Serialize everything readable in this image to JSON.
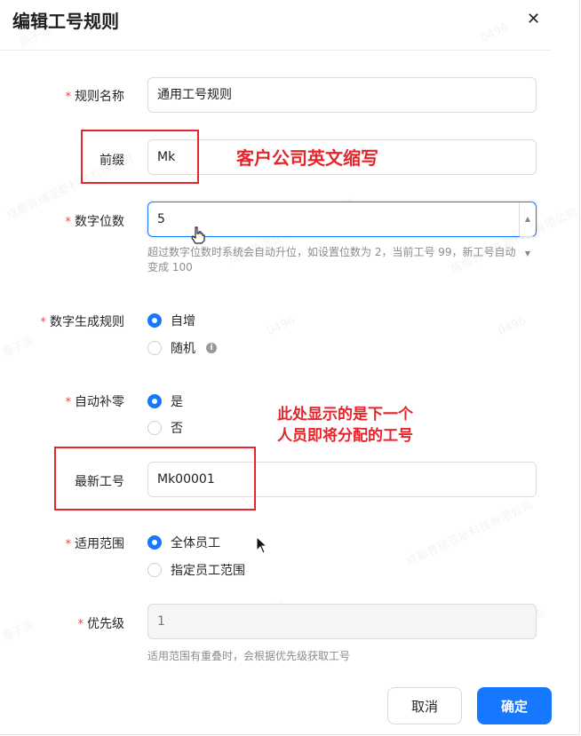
{
  "dialog": {
    "title": "编辑工号规则",
    "close_icon": "close-icon"
  },
  "form": {
    "rule_name": {
      "label": "规则名称",
      "required": "*",
      "value": "通用工号规则"
    },
    "prefix": {
      "label": "前缀",
      "value": "Mk"
    },
    "digit_count": {
      "label": "数字位数",
      "required": "*",
      "value": "5",
      "hint_line1": "超过数字位数时系统会自动升位，如设置位数为 2，当前工号 99，新工号自动",
      "hint_line2": "变成 100"
    },
    "generation_rule": {
      "label": "数字生成规则",
      "required": "*",
      "options": [
        "自增",
        "随机"
      ],
      "selected": "自增",
      "info_icon": "i"
    },
    "zero_padding": {
      "label": "自动补零",
      "required": "*",
      "options": [
        "是",
        "否"
      ],
      "selected": "是"
    },
    "latest_number": {
      "label": "最新工号",
      "value": "Mk00001"
    },
    "scope": {
      "label": "适用范围",
      "required": "*",
      "options": [
        "全体员工",
        "指定员工范围"
      ],
      "selected": "全体员工"
    },
    "priority": {
      "label": "优先级",
      "required": "*",
      "placeholder": "1",
      "hint": "适用范围有重叠时，会根据优先级获取工号"
    }
  },
  "footer": {
    "cancel_label": "取消",
    "confirm_label": "确定"
  },
  "annotations": {
    "prefix_note": "客户公司英文缩写",
    "latest_note_line1": "此处显示的是下一个",
    "latest_note_line2": "人员即将分配的工号"
  },
  "watermark": {
    "number": "0496",
    "company": "成都普瑞亚斯科技有限公司",
    "name": "周子深"
  },
  "colors": {
    "accent": "#1677ff",
    "required": "#e34d59",
    "annotation": "#e6252b"
  }
}
